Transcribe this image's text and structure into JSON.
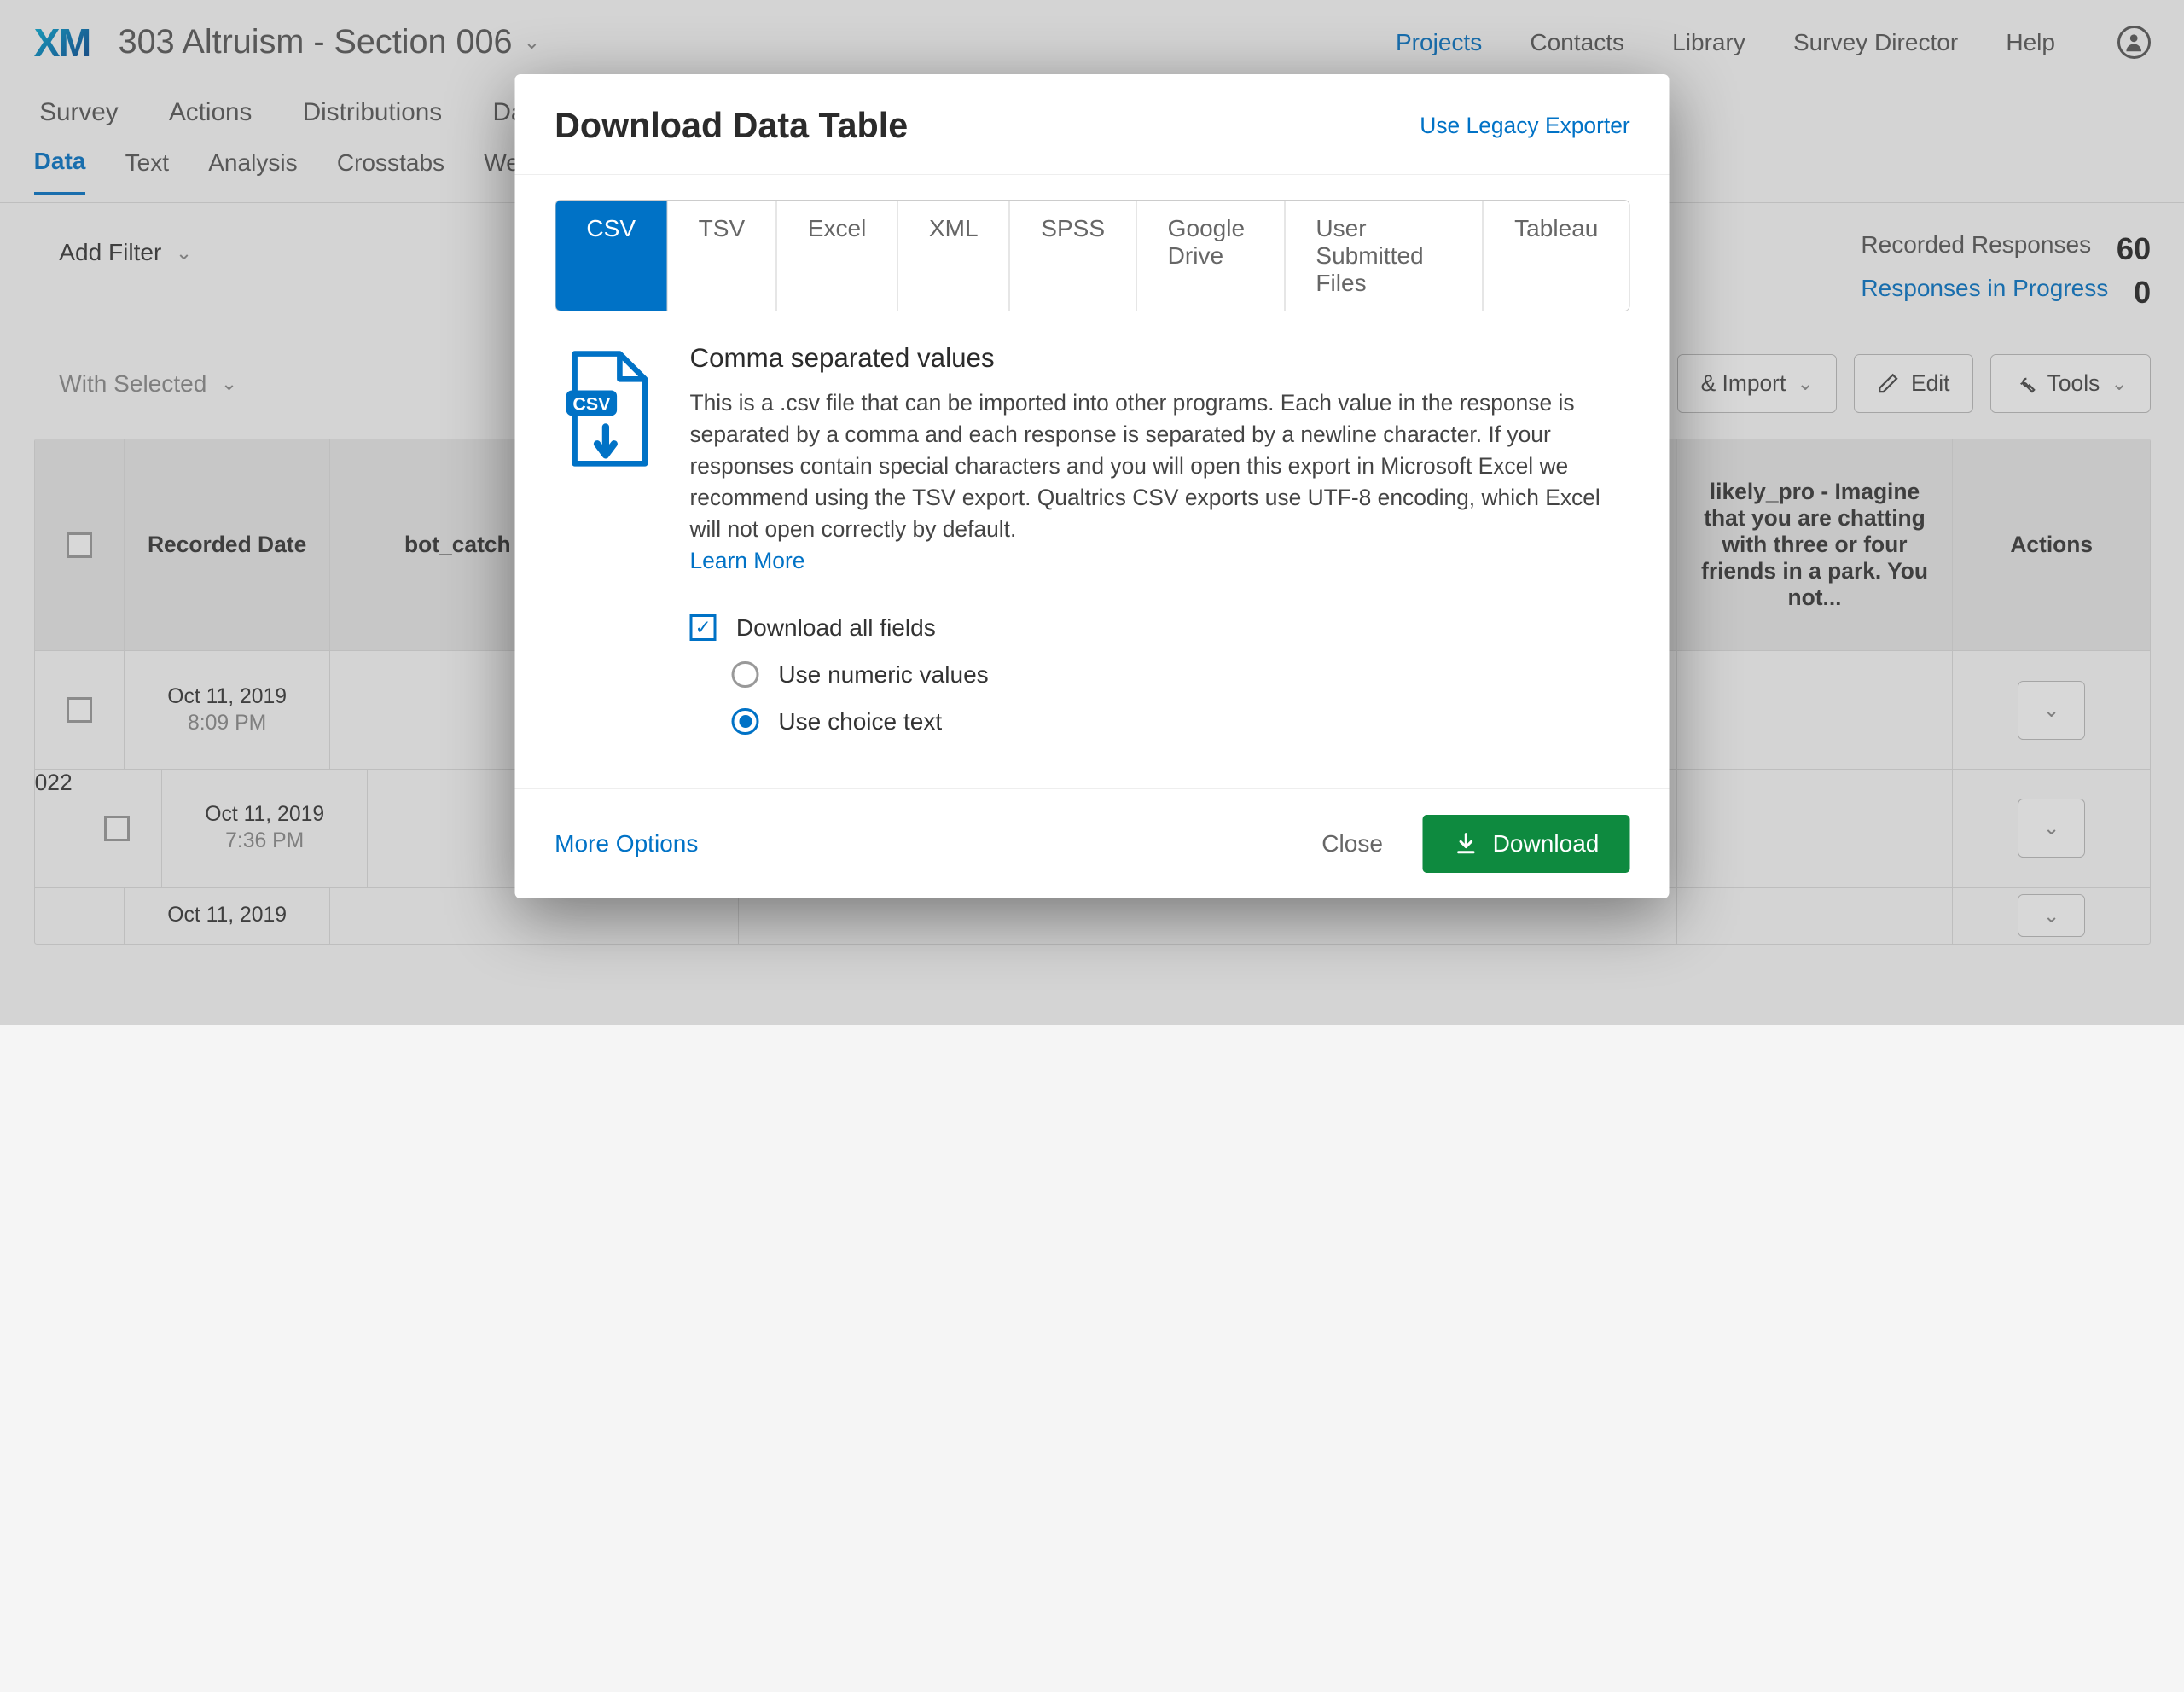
{
  "header": {
    "logo": "XM",
    "project_title": "303 Altruism - Section 006",
    "nav": {
      "projects": "Projects",
      "contacts": "Contacts",
      "library": "Library",
      "survey_director": "Survey Director",
      "help": "Help"
    }
  },
  "main_nav": {
    "survey": "Survey",
    "actions": "Actions",
    "distributions": "Distributions",
    "data_partial": "Da"
  },
  "sub_nav": {
    "data": "Data",
    "text": "Text",
    "analysis": "Analysis",
    "crosstabs": "Crosstabs",
    "weighting": "Weighting"
  },
  "toolbar": {
    "add_filter": "Add Filter",
    "recorded_label": "Recorded Responses",
    "recorded_value": "60",
    "in_progress_label": "Responses in Progress",
    "in_progress_value": "0",
    "with_selected": "With Selected",
    "export_import": "& Import",
    "edit": "Edit",
    "tools": "Tools"
  },
  "table": {
    "headers": {
      "recorded_date": "Recorded Date",
      "bot_catch": "bot_catch explain why y",
      "likely_pro": "likely_pro - Imagine that you are chatting with three or four friends in a park. You not...",
      "actions": "Actions"
    },
    "rows": [
      {
        "date": "Oct 11, 2019",
        "time": "8:09 PM"
      },
      {
        "date": "Oct 11, 2019",
        "time": "7:36 PM"
      },
      {
        "date": "Oct 11, 2019",
        "time": ""
      }
    ]
  },
  "modal": {
    "title": "Download Data Table",
    "legacy": "Use Legacy Exporter",
    "tabs": {
      "csv": "CSV",
      "tsv": "TSV",
      "excel": "Excel",
      "xml": "XML",
      "spss": "SPSS",
      "gdrive": "Google Drive",
      "user_files": "User Submitted Files",
      "tableau": "Tableau"
    },
    "csv_heading": "Comma separated values",
    "csv_desc": "This is a .csv file that can be imported into other programs. Each value in the response is separated by a comma and each response is separated by a newline character. If your responses contain special characters and you will open this export in Microsoft Excel we recommend using the TSV export. Qualtrics CSV exports use UTF-8 encoding, which Excel will not open correctly by default.",
    "learn_more": "Learn More",
    "download_all_fields": "Download all fields",
    "use_numeric": "Use numeric values",
    "use_choice": "Use choice text",
    "more_options": "More Options",
    "close": "Close",
    "download": "Download"
  }
}
